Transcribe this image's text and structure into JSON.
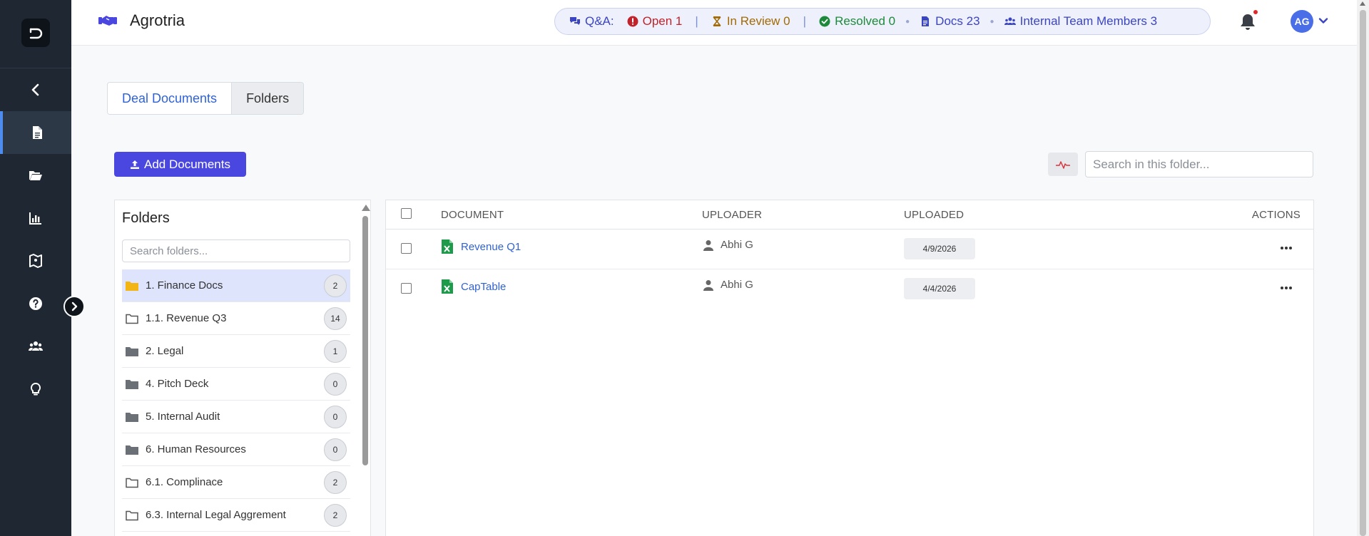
{
  "app": {
    "title": "Agrotria",
    "brand_icon": "handshake-icon"
  },
  "stats": {
    "qa_label": "Q&A:",
    "open": "Open 1",
    "in_review": "In Review 0",
    "resolved": "Resolved 0",
    "docs": "Docs 23",
    "team": "Internal Team Members 3"
  },
  "user": {
    "initials": "AG"
  },
  "sidebar": {
    "items": [
      {
        "icon": "chevron-left-icon"
      },
      {
        "icon": "document-icon",
        "active": true
      },
      {
        "icon": "folder-open-icon"
      },
      {
        "icon": "bar-chart-icon"
      },
      {
        "icon": "map-icon"
      },
      {
        "icon": "question-icon"
      },
      {
        "icon": "users-icon"
      },
      {
        "icon": "lightbulb-icon"
      }
    ]
  },
  "tabs": [
    {
      "label": "Deal Documents",
      "active": true
    },
    {
      "label": "Folders",
      "active": false
    }
  ],
  "toolbar": {
    "add_label": "Add Documents",
    "search_placeholder": "Search in this folder..."
  },
  "folders": {
    "title": "Folders",
    "search_placeholder": "Search folders...",
    "items": [
      {
        "name": "1. Finance Docs",
        "count": "2",
        "style": "filled-yellow",
        "active": true
      },
      {
        "name": "1.1. Revenue Q3",
        "count": "14",
        "style": "outline"
      },
      {
        "name": "2. Legal",
        "count": "1",
        "style": "filled-gray"
      },
      {
        "name": "4. Pitch Deck",
        "count": "0",
        "style": "filled-gray"
      },
      {
        "name": "5. Internal Audit",
        "count": "0",
        "style": "filled-gray"
      },
      {
        "name": "6. Human Resources",
        "count": "0",
        "style": "filled-gray"
      },
      {
        "name": "6.1. Complinace",
        "count": "2",
        "style": "outline"
      },
      {
        "name": "6.3. Internal Legal Aggrement",
        "count": "2",
        "style": "outline"
      }
    ]
  },
  "table": {
    "headers": {
      "document": "DOCUMENT",
      "uploader": "UPLOADER",
      "uploaded": "UPLOADED",
      "actions": "ACTIONS"
    },
    "rows": [
      {
        "document": "Revenue Q1",
        "uploader": "Abhi G",
        "uploaded": "4/9/2026"
      },
      {
        "document": "CapTable",
        "uploader": "Abhi G",
        "uploaded": "4/4/2026"
      }
    ]
  },
  "colors": {
    "sidebar_bg": "#1f2733",
    "accent": "#4a47e0",
    "link": "#2f62d8",
    "open_red": "#c0232b",
    "review_amber": "#a26a05",
    "resolved_green": "#1d8a3b",
    "excel_green": "#1d9a4a"
  }
}
